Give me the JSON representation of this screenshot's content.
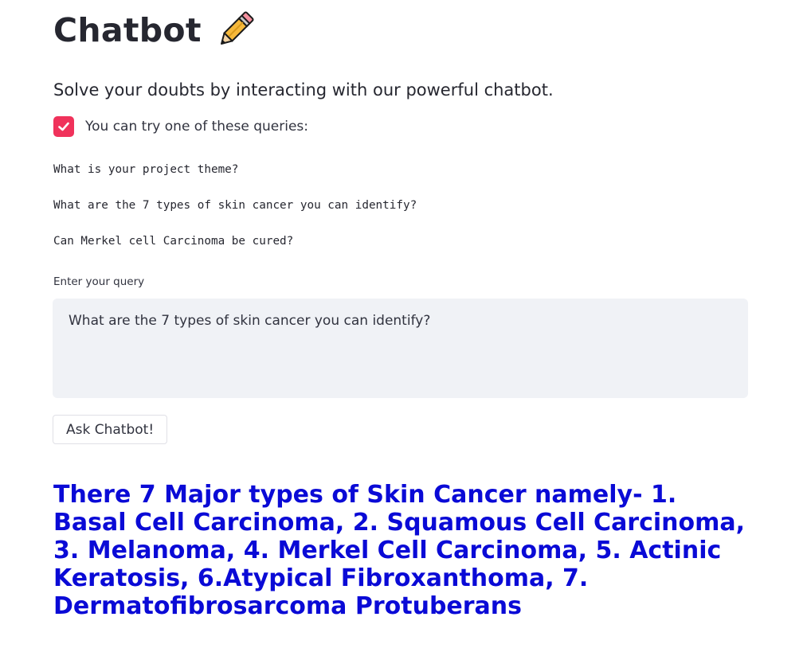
{
  "header": {
    "title": "Chatbot",
    "title_icon": "pencil-icon"
  },
  "subtitle": "Solve your doubts by interacting with our powerful chatbot.",
  "examples_toggle": {
    "checked": true,
    "label": "You can try one of these queries:",
    "accent_color": "#f0325b"
  },
  "example_queries": [
    "What is your project theme?",
    "What are the 7 types of skin cancer you can identify?",
    "Can Merkel cell Carcinoma be cured?"
  ],
  "query_input": {
    "label": "Enter your query",
    "value": "What are the 7 types of skin cancer you can identify?"
  },
  "ask_button": {
    "label": "Ask Chatbot!"
  },
  "answer": {
    "text": "There 7 Major types of Skin Cancer namely- 1. Basal Cell Carcinoma, 2. Squamous Cell Carcinoma, 3. Melanoma, 4. Merkel Cell Carcinoma, 5. Actinic Keratosis, 6.Atypical Fibroxanthoma, 7. Dermatofibrosarcoma Protuberans",
    "color": "#0a0ad6"
  }
}
